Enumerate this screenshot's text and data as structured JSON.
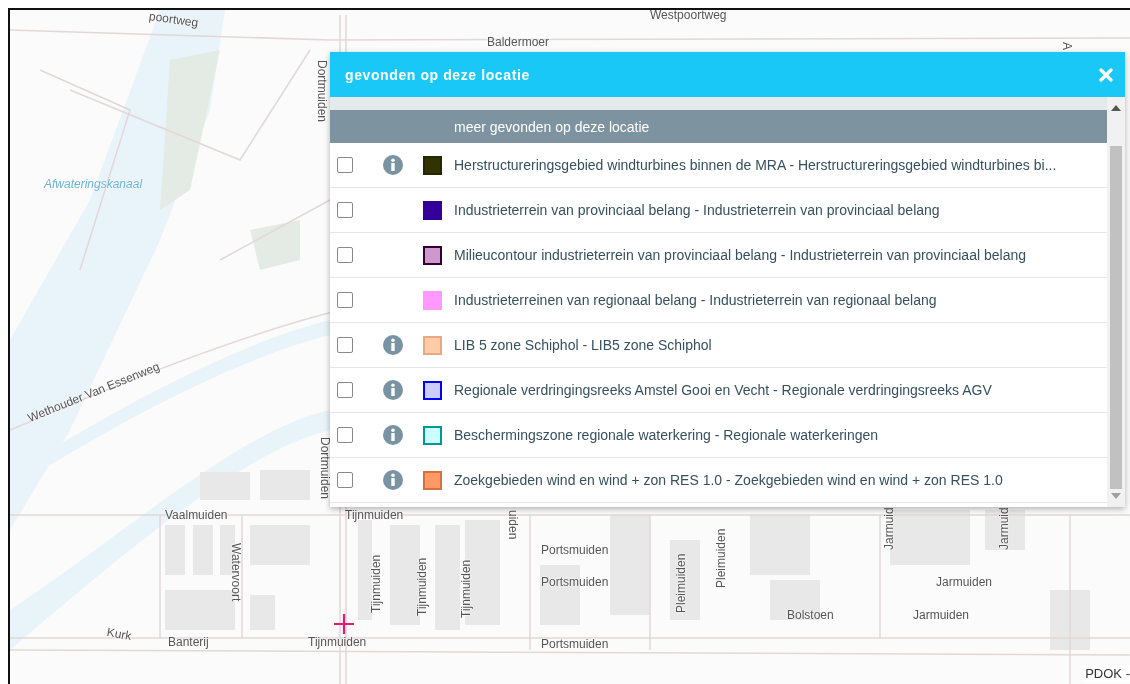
{
  "map": {
    "labels": [
      "poortweg",
      "Westpoortweg",
      "Baldermoer",
      "A",
      "Dortmuiden",
      "Afwateringskanaal",
      "Wethouder Van Essenweg",
      "Dortmuiden",
      "Vaalmuiden",
      "Tijnmuiden",
      "uiden",
      "Tijnmuiden",
      "Tijnmuiden",
      "Tijnmuiden",
      "Watervoort",
      "Kurk",
      "Banterij",
      "Tijnmuiden",
      "Portsmuiden",
      "Portsmuiden",
      "Portsmuiden",
      "Pleimuiden",
      "Pleimuiden",
      "Jarmuid",
      "Jarmuid",
      "Jarmuiden",
      "Jarmuiden",
      "Bolstoen"
    ],
    "attribution": "PDOK -"
  },
  "popup": {
    "title": "gevonden op deze locatie",
    "column_header": "meer gevonden op deze locatie",
    "rows": [
      {
        "checked": false,
        "has_info": true,
        "color": "#333300",
        "outline": {
          "color": "#262600"
        },
        "label": "Herstructureringsgebied windturbines binnen de MRA - Herstructureringsgebied windturbines bi..."
      },
      {
        "checked": false,
        "has_info": false,
        "color": "#330099",
        "outline": {
          "color": "#330099"
        },
        "label": "Industrieterrein van provinciaal belang - Industrieterrein van provinciaal belang"
      },
      {
        "checked": false,
        "has_info": false,
        "color": "#cc99cc",
        "outline": {
          "color": "#330033"
        },
        "label": "Milieucontour industrieterrein van provinciaal belang - Industrieterrein van provinciaal belang"
      },
      {
        "checked": false,
        "has_info": false,
        "color": "#ff99ff",
        "outline": {
          "color": "#ff99ff"
        },
        "label": "Industrieterreinen van regionaal belang - Industrieterrein van regionaal belang"
      },
      {
        "checked": false,
        "has_info": true,
        "color": "#ffccaa",
        "outline": {
          "color": "#e8a882"
        },
        "label": "LIB 5 zone Schiphol - LIB5 zone Schiphol"
      },
      {
        "checked": false,
        "has_info": true,
        "color": "#ccccff",
        "outline": {
          "color": "#0000ff"
        },
        "label": "Regionale verdringingsreeks Amstel Gooi en Vecht - Regionale verdringingsreeks AGV"
      },
      {
        "checked": false,
        "has_info": true,
        "color": "#ccffff",
        "outline": {
          "color": "#009999"
        },
        "label": "Beschermingszone regionale waterkering - Regionale waterkeringen"
      },
      {
        "checked": false,
        "has_info": true,
        "color": "#ff9966",
        "outline": {
          "color": "#d9713f"
        },
        "label": "Zoekgebieden wind en wind + zon RES 1.0 - Zoekgebieden wind en wind + zon RES 1.0"
      }
    ]
  }
}
